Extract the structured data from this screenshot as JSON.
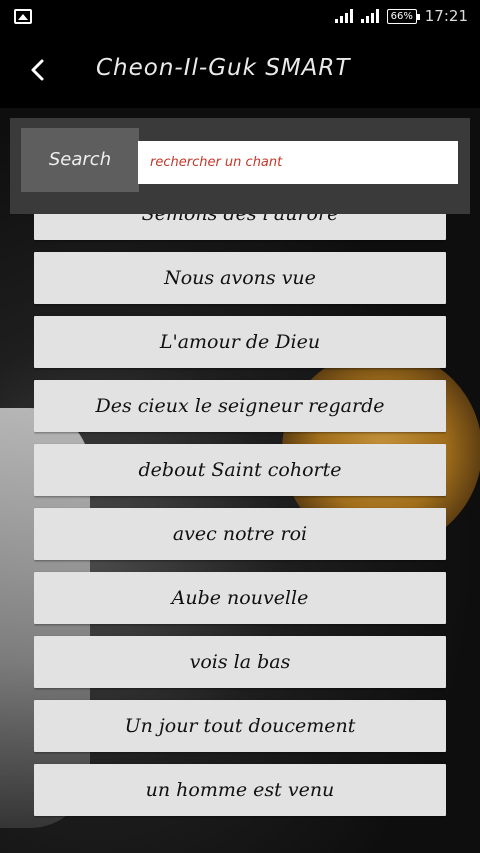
{
  "status_bar": {
    "battery": "66%",
    "time": "17:21"
  },
  "app_bar": {
    "title": "Cheon-Il-Guk SMART"
  },
  "search": {
    "button_label": "Search",
    "placeholder": "rechercher un chant",
    "value": ""
  },
  "songs": [
    "Semons dès l'aurore",
    "Nous avons vue",
    "L'amour de Dieu",
    "Des cieux le seigneur regarde",
    "debout Saint cohorte",
    "avec notre roi",
    "Aube nouvelle",
    "vois la bas",
    "Un jour tout doucement",
    "un homme est venu"
  ],
  "colors": {
    "accent_text": "#c0392b",
    "list_item_bg": "#e2e2e2",
    "search_bar_bg": "#3a3a3a"
  }
}
